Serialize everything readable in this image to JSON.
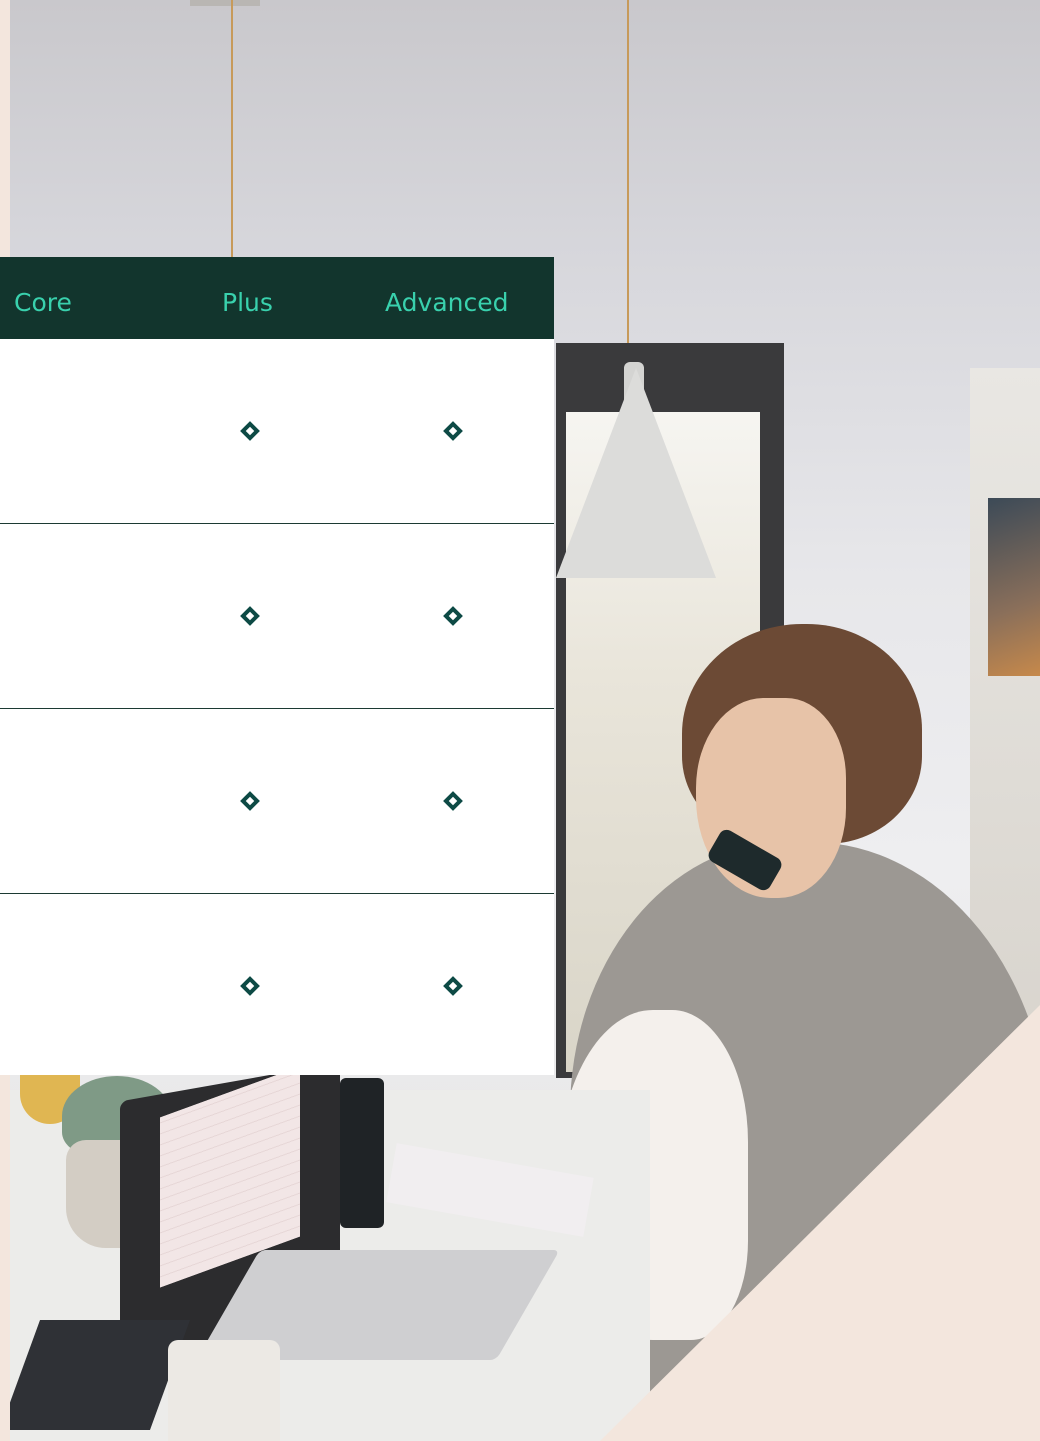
{
  "comparison_table": {
    "columns": [
      "Core",
      "Plus",
      "Advanced"
    ],
    "rows": [
      {
        "core": false,
        "plus": true,
        "advanced": true
      },
      {
        "core": false,
        "plus": true,
        "advanced": true
      },
      {
        "core": false,
        "plus": true,
        "advanced": true
      },
      {
        "core": false,
        "plus": true,
        "advanced": true
      }
    ],
    "check_icon": "diamond-outline-icon"
  },
  "colors": {
    "header_background": "#12352d",
    "header_text": "#39d1ad",
    "check_color": "#0d4a45",
    "accent_beige": "#f3e6dd"
  }
}
